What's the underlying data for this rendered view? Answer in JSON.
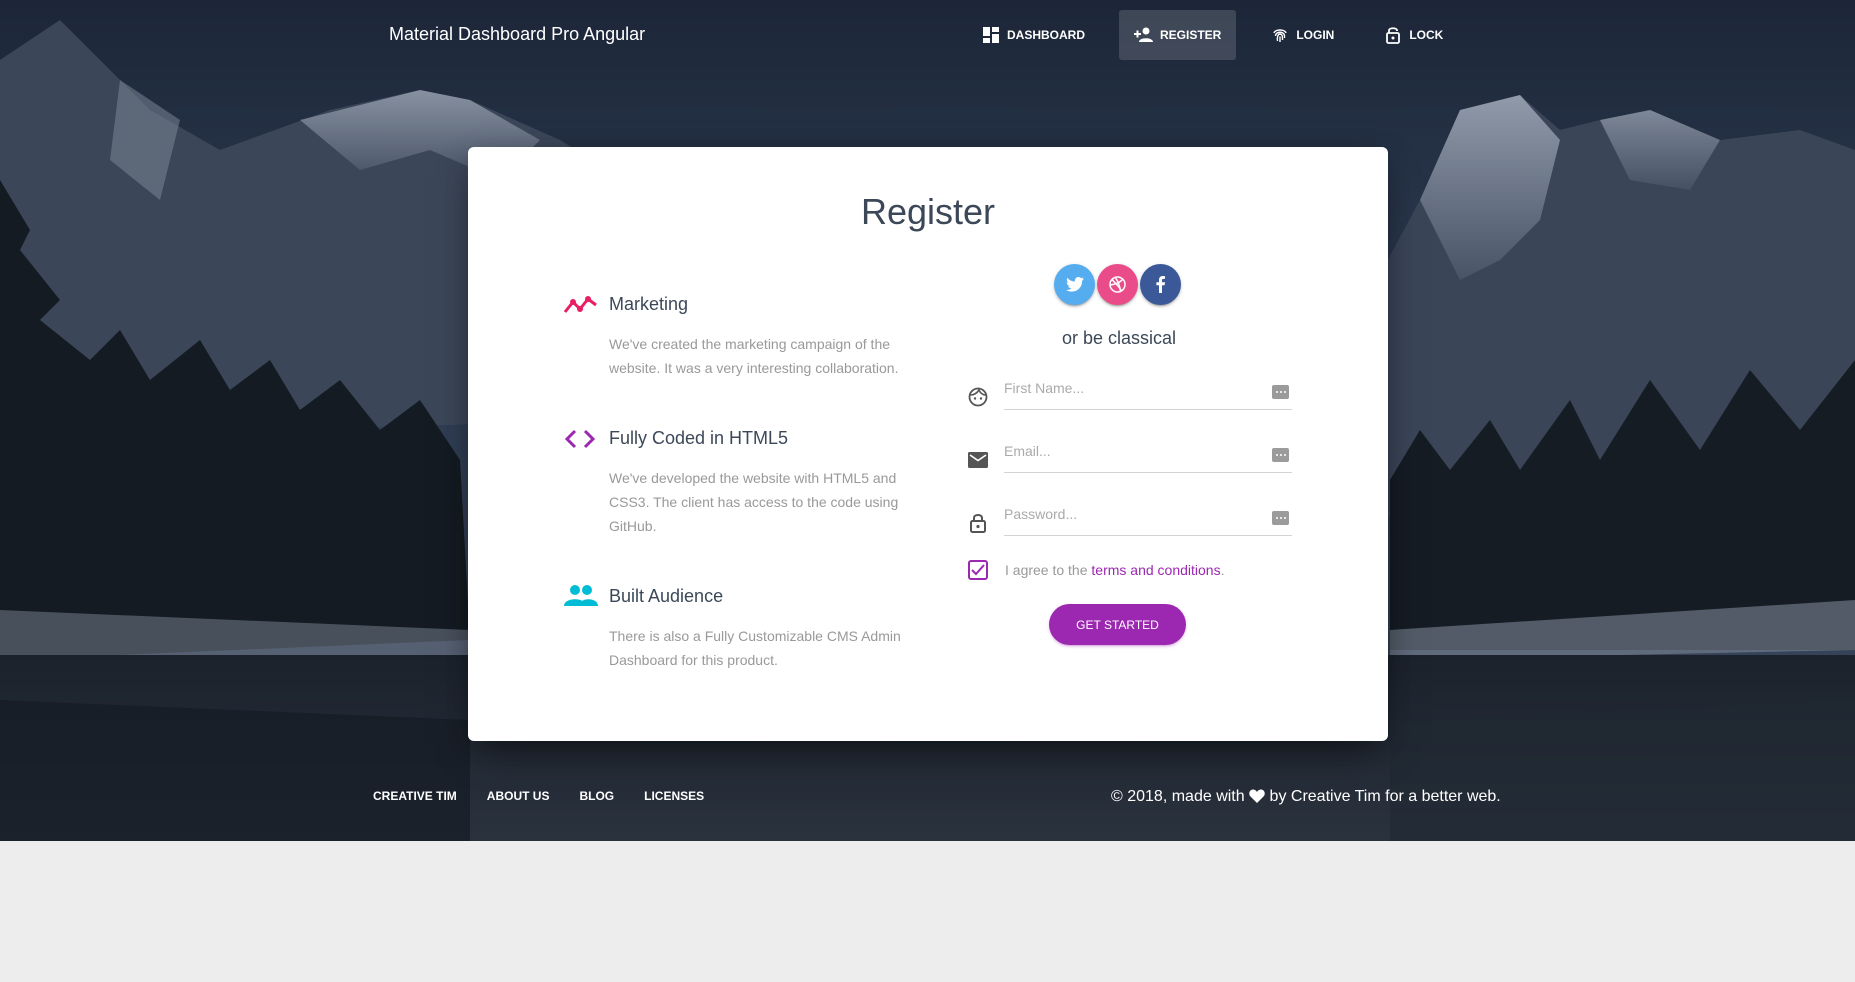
{
  "navbar": {
    "brand": "Material Dashboard Pro Angular",
    "items": [
      {
        "label": "Dashboard",
        "icon": "dashboard-icon",
        "active": false
      },
      {
        "label": "Register",
        "icon": "person-add-icon",
        "active": true
      },
      {
        "label": "Login",
        "icon": "fingerprint-icon",
        "active": false
      },
      {
        "label": "Lock",
        "icon": "lock-open-icon",
        "active": false
      }
    ]
  },
  "card": {
    "title": "Register",
    "features": [
      {
        "title": "Marketing",
        "text": "We've created the marketing campaign of the website. It was a very interesting collaboration.",
        "icon": "timeline-icon",
        "color": "#e91e63"
      },
      {
        "title": "Fully Coded in HTML5",
        "text": "We've developed the website with HTML5 and CSS3. The client has access to the code using GitHub.",
        "icon": "code-icon",
        "color": "#9c27b0"
      },
      {
        "title": "Built Audience",
        "text": "There is also a Fully Customizable CMS Admin Dashboard for this product.",
        "icon": "group-icon",
        "color": "#00bcd4"
      }
    ],
    "socials": [
      {
        "name": "twitter-icon",
        "color": "#55acee"
      },
      {
        "name": "dribbble-icon",
        "color": "#ea4c89"
      },
      {
        "name": "facebook-icon",
        "color": "#3b5998"
      }
    ],
    "classical": "or be classical",
    "form": {
      "first_name": {
        "placeholder": "First Name...",
        "value": "",
        "icon": "face-icon"
      },
      "email": {
        "placeholder": "Email...",
        "value": "",
        "icon": "email-icon"
      },
      "password": {
        "placeholder": "Password...",
        "value": "",
        "icon": "lock-icon"
      },
      "agree_prefix": "I agree to the ",
      "agree_link": "terms and conditions",
      "agree_suffix": ".",
      "agree_checked": true,
      "submit_label": "Get Started"
    }
  },
  "footer": {
    "links": [
      "Creative Tim",
      "About Us",
      "Blog",
      "Licenses"
    ],
    "copyright_prefix": "© 2018, made with",
    "copyright_suffix": "by Creative Tim for a better web."
  },
  "colors": {
    "primary": "#9c27b0",
    "rose": "#e91e63",
    "info": "#00bcd4"
  }
}
